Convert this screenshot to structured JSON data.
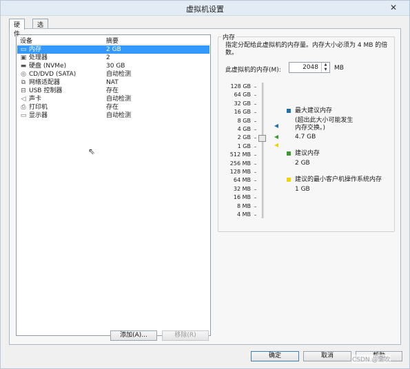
{
  "window": {
    "title": "虚拟机设置",
    "close": "✕"
  },
  "tabs": [
    {
      "label": "硬件"
    },
    {
      "label": "选项"
    }
  ],
  "device_list": {
    "col_device": "设备",
    "col_summary": "摘要",
    "rows": [
      {
        "icon": "memory-icon",
        "glyph": "▭",
        "name": "内存",
        "summary": "2 GB",
        "selected": true
      },
      {
        "icon": "processor-icon",
        "glyph": "▣",
        "name": "处理器",
        "summary": "2"
      },
      {
        "icon": "disk-icon",
        "glyph": "▬",
        "name": "硬盘 (NVMe)",
        "summary": "30 GB"
      },
      {
        "icon": "cd-dvd-icon",
        "glyph": "◎",
        "name": "CD/DVD (SATA)",
        "summary": "自动检测"
      },
      {
        "icon": "network-icon",
        "glyph": "⧉",
        "name": "网络适配器",
        "summary": "NAT"
      },
      {
        "icon": "usb-icon",
        "glyph": "⊟",
        "name": "USB 控制器",
        "summary": "存在"
      },
      {
        "icon": "sound-icon",
        "glyph": "◁",
        "name": "声卡",
        "summary": "自动检测"
      },
      {
        "icon": "printer-icon",
        "glyph": "⎙",
        "name": "打印机",
        "summary": "存在"
      },
      {
        "icon": "display-icon",
        "glyph": "▭",
        "name": "显示器",
        "summary": "自动检测"
      }
    ],
    "add_button": "添加(A)...",
    "remove_button": "移除(R)"
  },
  "memory": {
    "group_title": "内存",
    "description": "指定分配给此虚拟机的内存量。内存大小必须为 4 MB 的倍数。",
    "field_label": "此虚拟机的内存(M):",
    "value": "2048",
    "unit": "MB",
    "scale": [
      "128 GB",
      "64 GB",
      "32 GB",
      "16 GB",
      "8 GB",
      "4 GB",
      "2 GB",
      "1 GB",
      "512 MB",
      "256 MB",
      "128 MB",
      "64 MB",
      "32 MB",
      "16 MB",
      "8 MB",
      "4 MB"
    ],
    "legend": {
      "max": {
        "title": "最大建议内存",
        "note": "(超出此大小可能发生内存交换。)",
        "value": "4.7 GB",
        "color": "#1f6fa8"
      },
      "recommended": {
        "title": "建议内存",
        "value": "2 GB",
        "color": "#3a9a2e"
      },
      "min_guest": {
        "title": "建议的最小客户机操作系统内存",
        "value": "1 GB",
        "color": "#f0d400"
      }
    }
  },
  "footer": {
    "ok": "确定",
    "cancel": "取消",
    "help": "帮助"
  },
  "watermark": "CSDN @懒吹"
}
